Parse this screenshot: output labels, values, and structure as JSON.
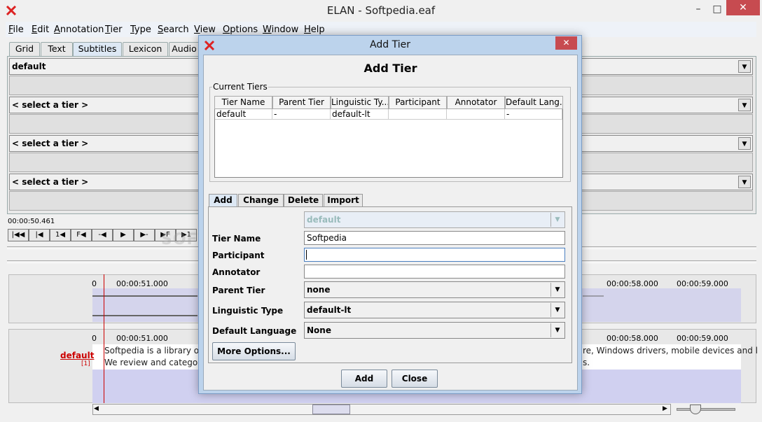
{
  "window": {
    "title": "ELAN - Softpedia.eaf",
    "controls": {
      "minimize": "–",
      "maximize": "□",
      "close": "✕"
    }
  },
  "menu": [
    "File",
    "Edit",
    "Annotation",
    "Tier",
    "Type",
    "Search",
    "View",
    "Options",
    "Window",
    "Help"
  ],
  "menu_underlines": [
    "F",
    "E",
    "A",
    "T",
    "T",
    "S",
    "V",
    "O",
    "W",
    "H"
  ],
  "tabs": [
    "Grid",
    "Text",
    "Subtitles",
    "Lexicon",
    "Audio"
  ],
  "subtitles": {
    "tier_combos": [
      "default",
      "< select a tier >",
      "< select a tier >",
      "< select a tier >"
    ]
  },
  "media": {
    "timecode": "00:00:50.461",
    "buttons": [
      "|◀◀",
      "|◀",
      "1◀",
      "F◀",
      "-◀",
      "▶",
      "▶-",
      "▶F",
      "▶1"
    ]
  },
  "ruler": {
    "start": "0",
    "labels": [
      "00:00:51.000",
      "00:00:58.000",
      "00:00:59.000"
    ]
  },
  "timeline": {
    "tier_name": "default",
    "tier_count": "[1]",
    "annotation_line1_start": "Softpedia is a library of c",
    "annotation_line1_end": "re, Windows drivers, mobile devices and l",
    "annotation_line2_start": "We review and categoriz",
    "annotation_line2_end": "s."
  },
  "watermark": "SOFTPEDIA",
  "dialog": {
    "title": "Add Tier",
    "heading": "Add Tier",
    "current_tiers_label": "Current Tiers",
    "columns": [
      "Tier Name",
      "Parent Tier",
      "Linguistic Ty...",
      "Participant",
      "Annotator",
      "Default Lang..."
    ],
    "rows": [
      [
        "default",
        "-",
        "default-lt",
        "",
        "",
        "-"
      ]
    ],
    "tabs": [
      "Add",
      "Change",
      "Delete",
      "Import"
    ],
    "form": {
      "tier_select": "default",
      "tier_name_label": "Tier Name",
      "tier_name_value": "Softpedia",
      "participant_label": "Participant",
      "participant_value": "",
      "annotator_label": "Annotator",
      "annotator_value": "",
      "parent_tier_label": "Parent Tier",
      "parent_tier_value": "none",
      "linguistic_type_label": "Linguistic Type",
      "linguistic_type_value": "default-lt",
      "default_language_label": "Default Language",
      "default_language_value": "None",
      "more_options": "More Options..."
    },
    "buttons": {
      "add": "Add",
      "close": "Close"
    }
  },
  "colors": {
    "close_button": "#c74b50",
    "dialog_frame": "#bcd3ec",
    "tier_label": "#cc0000",
    "wave_bg": "#d4d4ec"
  }
}
